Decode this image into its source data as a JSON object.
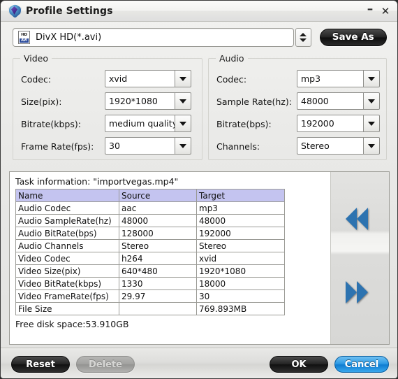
{
  "window": {
    "title": "Profile Settings",
    "icon": "shield-gem-icon",
    "minimize_label": "–",
    "close_label": "✕"
  },
  "profile": {
    "icon": "divx-hd-avi-file-icon",
    "icon_top_text": "HD",
    "icon_bottom_text": "AVI",
    "selected": "DivX HD(*.avi)",
    "save_as_label": "Save As"
  },
  "video": {
    "legend": "Video",
    "fields": [
      {
        "label": "Codec:",
        "value": "xvid"
      },
      {
        "label": "Size(pix):",
        "value": "1920*1080"
      },
      {
        "label": "Bitrate(kbps):",
        "value": "medium quality"
      },
      {
        "label": "Frame Rate(fps):",
        "value": "30"
      }
    ]
  },
  "audio": {
    "legend": "Audio",
    "fields": [
      {
        "label": "Codec:",
        "value": "mp3"
      },
      {
        "label": "Sample Rate(hz):",
        "value": "48000"
      },
      {
        "label": "Bitrate(bps):",
        "value": "192000"
      },
      {
        "label": "Channels:",
        "value": "Stereo"
      }
    ]
  },
  "task_info": {
    "title": "Task information: \"importvegas.mp4\"",
    "columns": [
      "Name",
      "Source",
      "Target"
    ],
    "rows": [
      {
        "name": "Audio Codec",
        "source": "aac",
        "target": "mp3"
      },
      {
        "name": "Audio SampleRate(hz)",
        "source": "48000",
        "target": "48000"
      },
      {
        "name": "Audio BitRate(bps)",
        "source": "128000",
        "target": "192000"
      },
      {
        "name": "Audio Channels",
        "source": "Stereo",
        "target": "Stereo"
      },
      {
        "name": "Video Codec",
        "source": "h264",
        "target": "xvid"
      },
      {
        "name": "Video Size(pix)",
        "source": "640*480",
        "target": "1920*1080"
      },
      {
        "name": "Video BitRate(kbps)",
        "source": "1330",
        "target": "18000"
      },
      {
        "name": "Video FrameRate(fps)",
        "source": "29.97",
        "target": "30"
      },
      {
        "name": "File Size",
        "source": "",
        "target": "769.893MB"
      }
    ],
    "disk_space": "Free disk space:53.910GB",
    "nav_prev": "previous-task",
    "nav_next": "next-task"
  },
  "footer": {
    "reset_label": "Reset",
    "delete_label": "Delete",
    "ok_label": "OK",
    "cancel_label": "Cancel"
  },
  "colors": {
    "table_header": "#c4c4f0",
    "accent_blue": "#2e9ae4",
    "arrow_blue": "#2d73b0"
  }
}
